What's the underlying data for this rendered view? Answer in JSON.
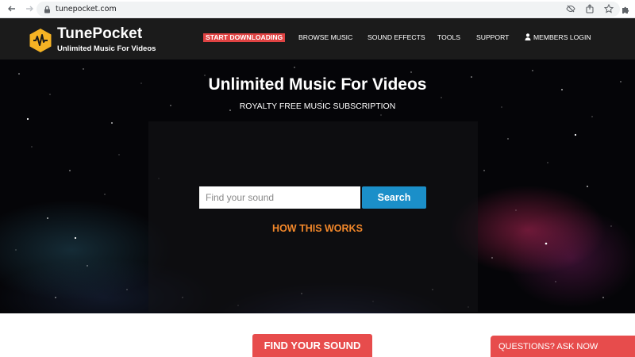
{
  "browser": {
    "url": "tunepocket.com"
  },
  "header": {
    "brand_name": "TunePocket",
    "brand_tagline": "Unlimited Music For Videos",
    "nav": {
      "start_downloading": "START DOWNLOADING",
      "browse_music": "BROWSE MUSIC",
      "sound_effects": "SOUND EFFECTS",
      "tools": "TOOLS",
      "support": "SUPPORT",
      "members_login": "MEMBERS LOGIN"
    }
  },
  "hero": {
    "title": "Unlimited Music For Videos",
    "subtitle": "ROYALTY FREE MUSIC SUBSCRIPTION",
    "search_placeholder": "Find your sound",
    "search_button": "Search",
    "how_link": "HOW THIS WORKS"
  },
  "below": {
    "find_button": "FIND YOUR SOUND",
    "ask_button": "QUESTIONS? ASK NOW"
  },
  "colors": {
    "header_bg": "#1b1b1b",
    "cta_red": "#e04343",
    "search_blue": "#1b8fc9",
    "accent_orange": "#f2872a",
    "logo_yellow": "#f5b324"
  },
  "icons": [
    "back-icon",
    "forward-icon",
    "reload-icon",
    "home-icon",
    "lock-icon",
    "eye-off-icon",
    "share-icon",
    "star-icon",
    "extensions-icon",
    "waveform-logo-icon",
    "user-icon"
  ]
}
